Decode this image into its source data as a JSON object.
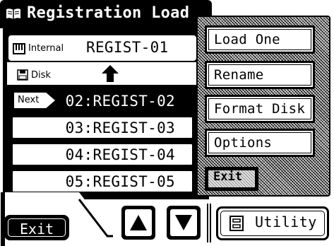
{
  "header": {
    "title": "Registration Load",
    "icon": "book-icon"
  },
  "source": {
    "internal_label": "Internal",
    "internal_value": "REGIST-01",
    "disk_label": "Disk",
    "transfer_icon": "up-arrow-icon"
  },
  "file_list": {
    "next_badge": "Next",
    "items": [
      {
        "label": "02:REGIST-02",
        "selected": true
      },
      {
        "label": "03:REGIST-03",
        "selected": false
      },
      {
        "label": "04:REGIST-04",
        "selected": false
      },
      {
        "label": "05:REGIST-05",
        "selected": false
      }
    ]
  },
  "footer": {
    "exit_label": "Exit",
    "scroll_up_icon": "up-triangle-icon",
    "scroll_down_icon": "down-triangle-icon",
    "utility_label": "Utility",
    "utility_icon": "utility-icon"
  },
  "utility_menu": {
    "items": [
      {
        "label": "Load One"
      },
      {
        "label": "Rename"
      },
      {
        "label": "Format Disk"
      },
      {
        "label": "Options"
      }
    ],
    "exit_label": "Exit"
  },
  "colors": {
    "foreground": "#000000",
    "background": "#ffffff",
    "dither_gray": "#9a9a9a"
  }
}
